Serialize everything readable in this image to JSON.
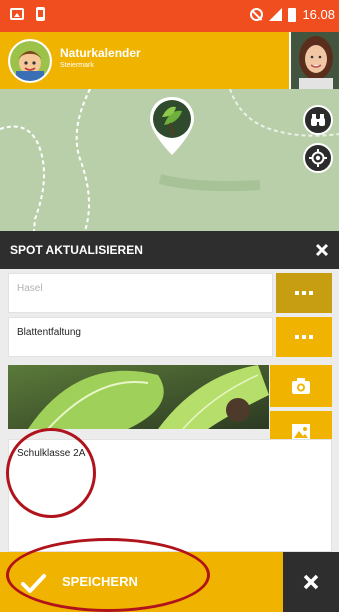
{
  "status_bar": {
    "time": "16.08",
    "icons": [
      "image-icon",
      "battery-icon",
      "dnd-icon",
      "signal-icon",
      "battery-level-icon"
    ]
  },
  "app_bar": {
    "title": "Naturkalender",
    "subtitle": "Steiermark"
  },
  "map": {
    "buttons": [
      "binoculars-icon",
      "locate-icon"
    ]
  },
  "dialog": {
    "title": "SPOT AKTUALISIEREN"
  },
  "form": {
    "species_value": "Hasel",
    "phase_value": "Blattentfaltung",
    "notes_value": "Schulklasse 2A",
    "photo_buttons": [
      "camera-icon",
      "gallery-icon"
    ]
  },
  "footer": {
    "save_label": "SPEICHERN"
  },
  "colors": {
    "status_bar": "#f04e1f",
    "accent": "#f0b400",
    "dark": "#2e2e2e",
    "annotation": "#b0131c",
    "map": "#b9cfaa"
  }
}
